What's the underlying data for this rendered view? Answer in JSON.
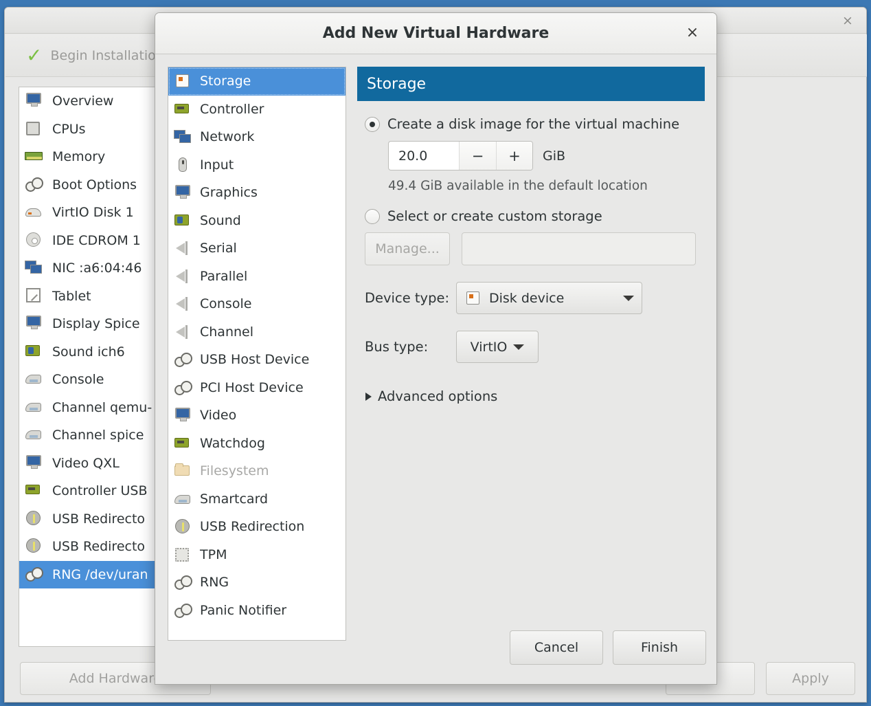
{
  "background_window": {
    "close_label": "×",
    "toolbar": {
      "begin_install_label": "Begin Installation",
      "check_icon": "check-icon"
    },
    "hardware_list": [
      {
        "label": "Overview",
        "icon": "monitor-icon",
        "selected": false
      },
      {
        "label": "CPUs",
        "icon": "cpu-chip-icon",
        "selected": false
      },
      {
        "label": "Memory",
        "icon": "memory-module-icon",
        "selected": false
      },
      {
        "label": "Boot Options",
        "icon": "gears-icon",
        "selected": false
      },
      {
        "label": "VirtIO Disk 1",
        "icon": "disk-icon",
        "selected": false
      },
      {
        "label": "IDE CDROM 1",
        "icon": "cdrom-icon",
        "selected": false
      },
      {
        "label": "NIC :a6:04:46",
        "icon": "network-icon",
        "selected": false
      },
      {
        "label": "Tablet",
        "icon": "tablet-icon",
        "selected": false
      },
      {
        "label": "Display Spice",
        "icon": "monitor-icon",
        "selected": false
      },
      {
        "label": "Sound ich6",
        "icon": "sound-card-icon",
        "selected": false
      },
      {
        "label": "Console",
        "icon": "printer-icon",
        "selected": false
      },
      {
        "label": "Channel qemu-",
        "icon": "printer-icon",
        "selected": false
      },
      {
        "label": "Channel spice",
        "icon": "printer-icon",
        "selected": false
      },
      {
        "label": "Video QXL",
        "icon": "monitor-icon",
        "selected": false
      },
      {
        "label": "Controller USB",
        "icon": "controller-card-icon",
        "selected": false
      },
      {
        "label": "USB Redirecto",
        "icon": "usb-icon",
        "selected": false
      },
      {
        "label": "USB Redirecto",
        "icon": "usb-icon",
        "selected": false
      },
      {
        "label": "RNG /dev/uran",
        "icon": "gears-icon",
        "selected": true
      }
    ],
    "buttons": {
      "add_hardware": "Add Hardware",
      "cancel": "el",
      "apply": "Apply"
    }
  },
  "dialog": {
    "title": "Add New Virtual Hardware",
    "close_label": "×",
    "device_list": [
      {
        "label": "Storage",
        "icon": "storage-icon",
        "selected": true,
        "disabled": false
      },
      {
        "label": "Controller",
        "icon": "controller-card-icon",
        "selected": false,
        "disabled": false
      },
      {
        "label": "Network",
        "icon": "network-icon",
        "selected": false,
        "disabled": false
      },
      {
        "label": "Input",
        "icon": "mouse-icon",
        "selected": false,
        "disabled": false
      },
      {
        "label": "Graphics",
        "icon": "monitor-icon",
        "selected": false,
        "disabled": false
      },
      {
        "label": "Sound",
        "icon": "sound-card-icon",
        "selected": false,
        "disabled": false
      },
      {
        "label": "Serial",
        "icon": "serial-port-icon",
        "selected": false,
        "disabled": false
      },
      {
        "label": "Parallel",
        "icon": "serial-port-icon",
        "selected": false,
        "disabled": false
      },
      {
        "label": "Console",
        "icon": "serial-port-icon",
        "selected": false,
        "disabled": false
      },
      {
        "label": "Channel",
        "icon": "serial-port-icon",
        "selected": false,
        "disabled": false
      },
      {
        "label": "USB Host Device",
        "icon": "gears-icon",
        "selected": false,
        "disabled": false
      },
      {
        "label": "PCI Host Device",
        "icon": "gears-icon",
        "selected": false,
        "disabled": false
      },
      {
        "label": "Video",
        "icon": "monitor-icon",
        "selected": false,
        "disabled": false
      },
      {
        "label": "Watchdog",
        "icon": "controller-card-icon",
        "selected": false,
        "disabled": false
      },
      {
        "label": "Filesystem",
        "icon": "folder-icon",
        "selected": false,
        "disabled": true
      },
      {
        "label": "Smartcard",
        "icon": "printer-icon",
        "selected": false,
        "disabled": false
      },
      {
        "label": "USB Redirection",
        "icon": "usb-icon",
        "selected": false,
        "disabled": false
      },
      {
        "label": "TPM",
        "icon": "tpm-chip-icon",
        "selected": false,
        "disabled": false
      },
      {
        "label": "RNG",
        "icon": "gears-icon",
        "selected": false,
        "disabled": false
      },
      {
        "label": "Panic Notifier",
        "icon": "gears-icon",
        "selected": false,
        "disabled": false
      }
    ],
    "pane": {
      "header": "Storage",
      "header_color": "#11699e",
      "selection_color": "#4a90d9",
      "create_disk": {
        "label": "Create a disk image for the virtual machine",
        "selected": true,
        "size_value": "20.0",
        "decrement_label": "−",
        "increment_label": "+",
        "unit": "GiB",
        "available_text": "49.4 GiB available in the default location"
      },
      "custom_storage": {
        "label": "Select or create custom storage",
        "selected": false,
        "manage_button": "Manage...",
        "path_value": "",
        "path_placeholder": ""
      },
      "device_type": {
        "label": "Device type:",
        "value": "Disk device",
        "icon": "storage-icon"
      },
      "bus_type": {
        "label": "Bus type:",
        "value": "VirtIO"
      },
      "advanced_options": {
        "label": "Advanced options",
        "expanded": false
      }
    },
    "buttons": {
      "cancel": "Cancel",
      "finish": "Finish"
    }
  }
}
